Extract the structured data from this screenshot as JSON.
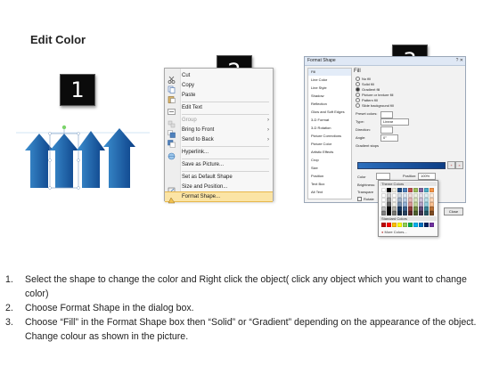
{
  "title": "Edit Color",
  "steps_badges": [
    "1",
    "2",
    "3"
  ],
  "context_menu": {
    "items": [
      {
        "label": "Cut",
        "icon": "scissors-icon",
        "enabled": true
      },
      {
        "label": "Copy",
        "icon": "copy-icon",
        "enabled": true
      },
      {
        "label": "Paste",
        "icon": "paste-icon",
        "enabled": true
      },
      {
        "label": "Edit Text",
        "icon": "edit-text-icon",
        "enabled": true
      },
      {
        "label": "Group",
        "icon": "group-icon",
        "enabled": false,
        "submenu": true
      },
      {
        "label": "Bring to Front",
        "icon": "bring-to-front-icon",
        "enabled": true,
        "submenu": true
      },
      {
        "label": "Send to Back",
        "icon": "send-to-back-icon",
        "enabled": true,
        "submenu": true
      },
      {
        "label": "Hyperlink...",
        "icon": "hyperlink-icon",
        "enabled": true
      },
      {
        "label": "Save as Picture...",
        "icon": "",
        "enabled": true
      },
      {
        "label": "Set as Default Shape",
        "icon": "",
        "enabled": true
      },
      {
        "label": "Size and Position...",
        "icon": "size-position-icon",
        "enabled": true
      },
      {
        "label": "Format Shape...",
        "icon": "format-shape-icon",
        "enabled": true,
        "highlighted": true
      }
    ]
  },
  "format_dialog": {
    "title": "Format Shape",
    "title_buttons": "? ✕",
    "categories": [
      "Fill",
      "Line Color",
      "Line Style",
      "Shadow",
      "Reflection",
      "Glow and Soft Edges",
      "3-D Format",
      "3-D Rotation",
      "Picture Corrections",
      "Picture Color",
      "Artistic Effects",
      "Crop",
      "Size",
      "Position",
      "Text Box",
      "Alt Text"
    ],
    "selected_category": "Fill",
    "section_heading": "Fill",
    "fill_options": [
      {
        "label": "No fill",
        "checked": false
      },
      {
        "label": "Solid fill",
        "checked": false
      },
      {
        "label": "Gradient fill",
        "checked": true
      },
      {
        "label": "Picture or texture fill",
        "checked": false
      },
      {
        "label": "Pattern fill",
        "checked": false
      },
      {
        "label": "Slide background fill",
        "checked": false
      }
    ],
    "fields": [
      {
        "label": "Preset colors:",
        "value": ""
      },
      {
        "label": "Type:",
        "value": "Linear"
      },
      {
        "label": "Direction:",
        "value": ""
      },
      {
        "label": "Angle:",
        "value": "0°"
      },
      {
        "label": "Gradient stops",
        "value": ""
      }
    ],
    "color_label": "Color",
    "position_label": "Position:",
    "position_value": "100%",
    "brightness_label": "Brightness:",
    "transparency_label": "Transpare",
    "rotate_label": "Rotate",
    "close_label": "Close",
    "gradient_colors": [
      "#2c6fbd",
      "#0d3e86"
    ]
  },
  "color_popup": {
    "theme_label": "Theme Colors",
    "standard_label": "Standard Colors",
    "more_label": "More Colors...",
    "theme_top": [
      "#ffffff",
      "#000000",
      "#eeece1",
      "#1f497d",
      "#4f81bd",
      "#c0504d",
      "#9bbb59",
      "#8064a2",
      "#4bacc6",
      "#f79646"
    ],
    "standard": [
      "#c00000",
      "#ff0000",
      "#ffc000",
      "#ffff00",
      "#92d050",
      "#00b050",
      "#00b0f0",
      "#0070c0",
      "#002060",
      "#7030a0"
    ]
  },
  "instructions": [
    {
      "num": "1.",
      "text": "Select the shape to change the color and Right click the object( click any object which you want to change color)"
    },
    {
      "num": "2.",
      "text": "Choose Format Shape in the dialog box."
    },
    {
      "num": "3.",
      "text": "Choose “Fill” in the Format Shape box then “Solid” or “Gradient” depending on the appearance of the object. Change colour as shown in the picture."
    }
  ],
  "arrow_colors": {
    "light": "#3c8fd0",
    "mid": "#1764b0",
    "dark": "#0b3f86"
  }
}
